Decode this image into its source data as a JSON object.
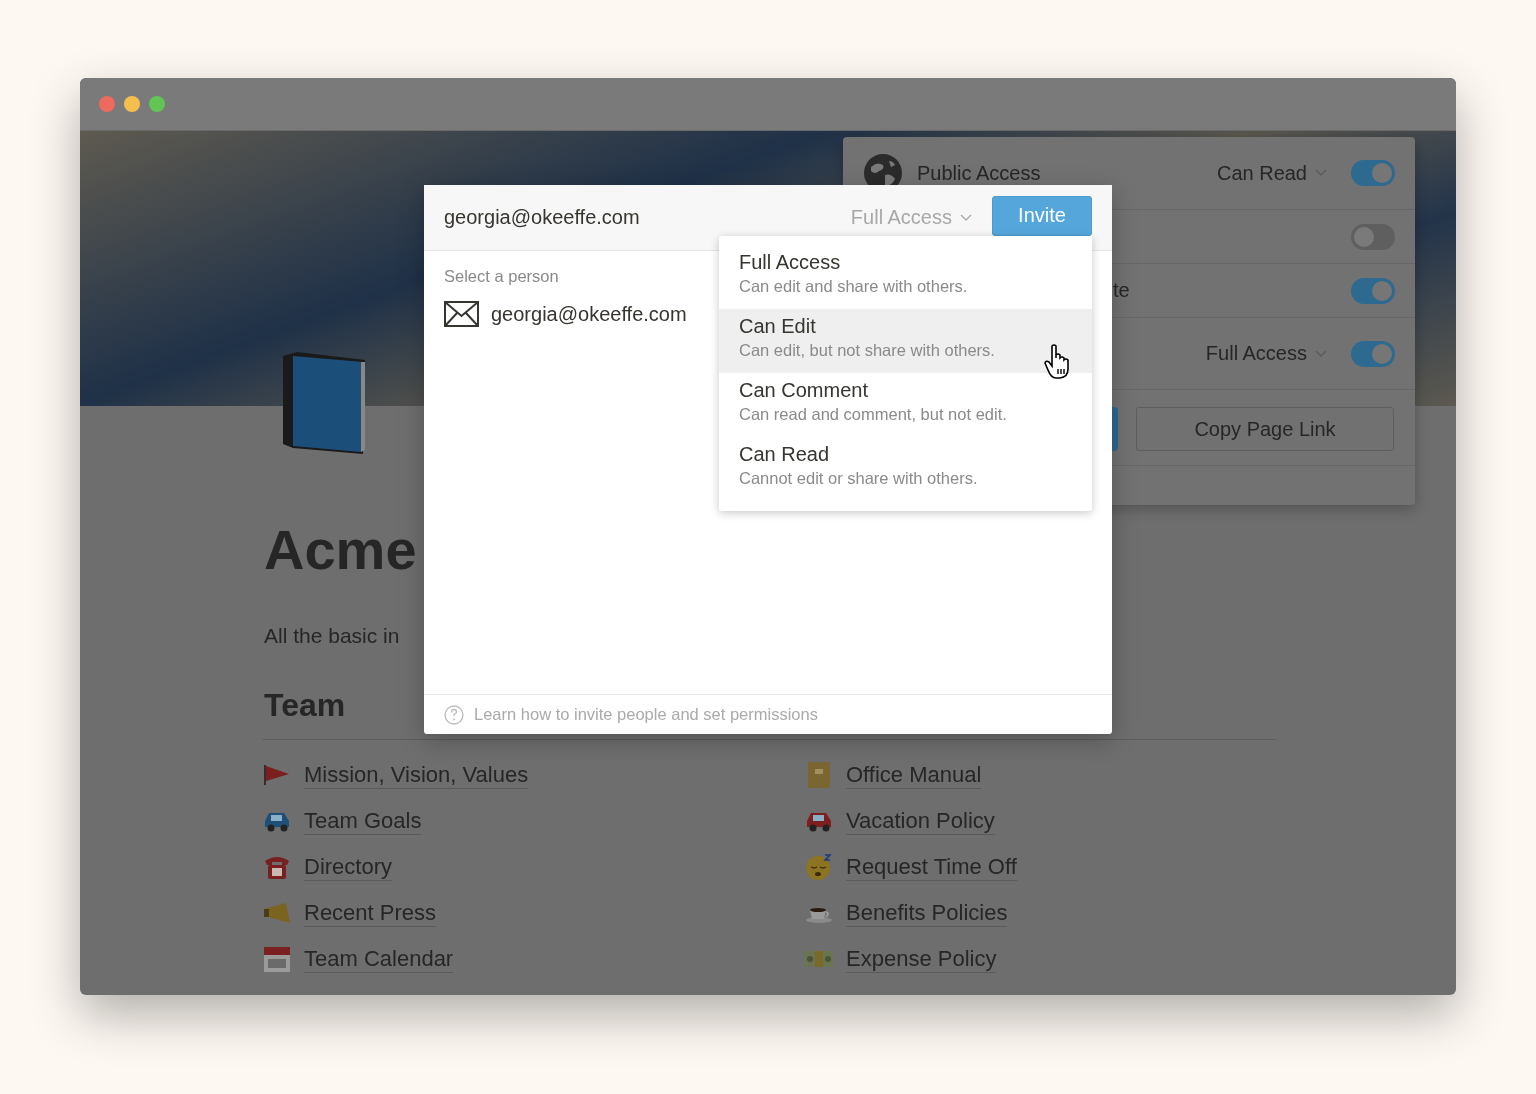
{
  "window": {
    "traffic_lights": [
      {
        "color": "#ec6a5e"
      },
      {
        "color": "#f4bf4f"
      },
      {
        "color": "#61c554"
      }
    ]
  },
  "page": {
    "title": "Acme",
    "subtitle": "All the basic in",
    "section_heading": "Team",
    "link_columns": [
      {
        "links": [
          {
            "label": "Mission, Vision, Values"
          },
          {
            "label": "Team Goals"
          },
          {
            "label": "Directory"
          },
          {
            "label": "Recent Press"
          },
          {
            "label": "Team Calendar"
          }
        ]
      },
      {
        "links": [
          {
            "label": "Office Manual"
          },
          {
            "label": "Vacation Policy"
          },
          {
            "label": "Request Time Off"
          },
          {
            "label": "Benefits Policies"
          },
          {
            "label": "Expense Policy"
          }
        ]
      }
    ]
  },
  "share_panel": {
    "rows": [
      {
        "kind": "public",
        "label": "Public Access",
        "permission": "Can Read",
        "on": true
      },
      {
        "kind": "toggle",
        "on": false
      },
      {
        "kind": "toggle",
        "label": "te",
        "on": true
      },
      {
        "kind": "permission",
        "permission": "Full Access",
        "on": true
      }
    ],
    "copy_link_button": "Copy Page Link"
  },
  "invite_dialog": {
    "email_field": {
      "value": "georgia@okeeffe.com"
    },
    "permission": "Full Access",
    "invite_button": "Invite",
    "section_label": "Select a person",
    "suggestion": "georgia@okeeffe.com",
    "help_link": "Learn how to invite people and set permissions",
    "menu": [
      {
        "title": "Full Access",
        "description": "Can edit and share with others.",
        "selected": false
      },
      {
        "title": "Can Edit",
        "description": "Can edit, but not share with others.",
        "selected": true
      },
      {
        "title": "Can Comment",
        "description": "Can read and comment, but not edit.",
        "selected": false
      },
      {
        "title": "Can Read",
        "description": "Cannot edit or share with others.",
        "selected": false
      }
    ]
  }
}
